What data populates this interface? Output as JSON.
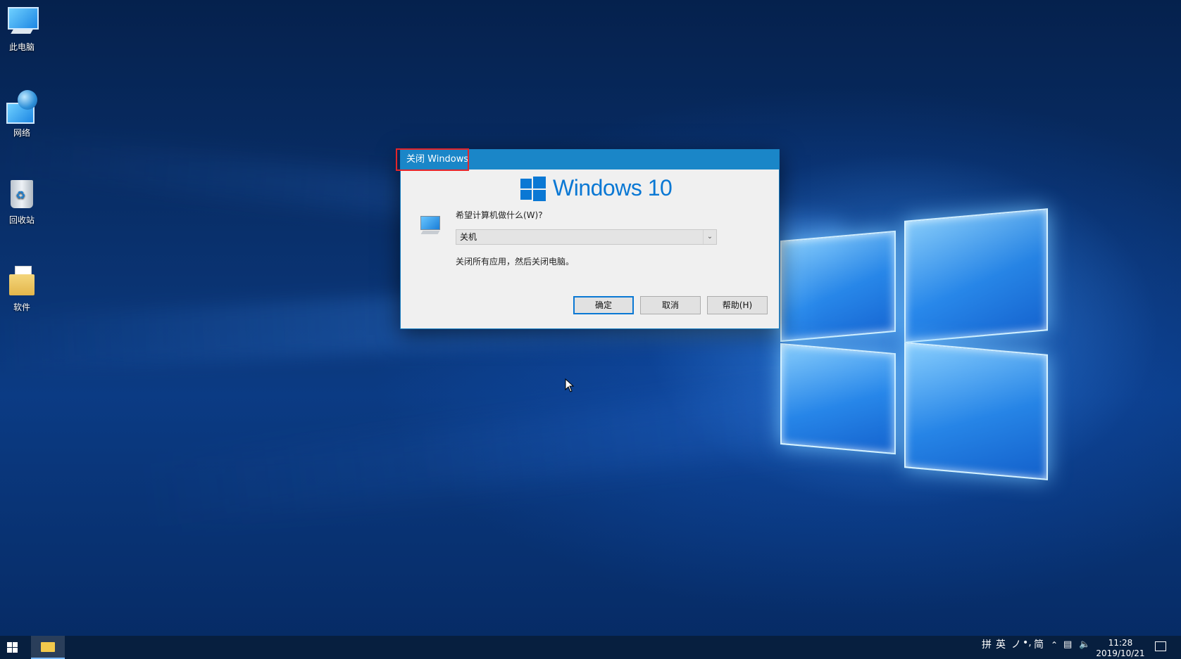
{
  "desktop": {
    "icons": [
      {
        "label": "此电脑",
        "icon": "this-pc-icon"
      },
      {
        "label": "网络",
        "icon": "network-icon"
      },
      {
        "label": "回收站",
        "icon": "recycle-bin-icon"
      },
      {
        "label": "软件",
        "icon": "folder-icon"
      }
    ]
  },
  "dialog": {
    "title": "关闭 Windows",
    "brand": "Windows 10",
    "prompt": "希望计算机做什么(W)?",
    "select_value": "关机",
    "description": "关闭所有应用，然后关闭电脑。",
    "ok_label": "确定",
    "cancel_label": "取消",
    "help_label": "帮助(H)",
    "accent": "#1a86c8",
    "highlight_color": "#e5252a"
  },
  "taskbar": {
    "ime": [
      "拼",
      "英",
      "ノ",
      "•,",
      "简"
    ],
    "time": "11:28",
    "date": "2019/10/21"
  }
}
